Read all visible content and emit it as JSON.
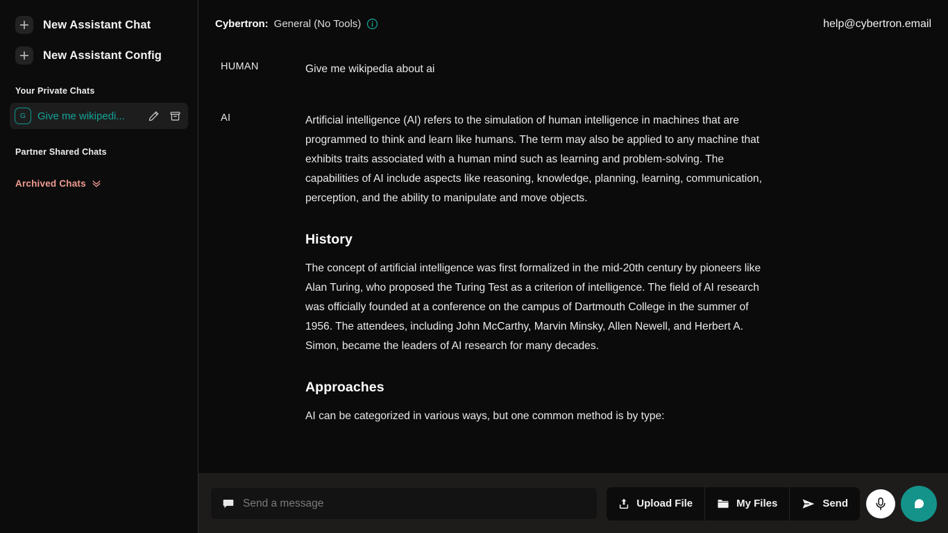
{
  "sidebar": {
    "new_chat_label": "New Assistant Chat",
    "new_config_label": "New Assistant Config",
    "private_chats_label": "Your Private Chats",
    "partner_chats_label": "Partner Shared Chats",
    "archived_chats_label": "Archived Chats",
    "chat_item": {
      "avatar_initial": "G",
      "title": "Give me wikipedi...",
      "edit_icon": "pencil-icon",
      "archive_icon": "archive-icon"
    },
    "new_icon": "plus-icon",
    "archived_icon": "chevron-double-down-icon",
    "accent_color": "#13a596",
    "archived_color": "#ef9b91"
  },
  "header": {
    "assistant_name": "Cybertron:",
    "assistant_mode": "General (No Tools)",
    "info_icon": "info-circle-icon",
    "account_email": "help@cybertron.email"
  },
  "conversation": {
    "messages": [
      {
        "role": "HUMAN",
        "paragraphs": [
          "Give me wikipedia about ai"
        ]
      },
      {
        "role": "AI",
        "paragraphs": [
          "Artificial intelligence (AI) refers to the simulation of human intelligence in machines that are programmed to think and learn like humans. The term may also be applied to any machine that exhibits traits associated with a human mind such as learning and problem-solving. The capabilities of AI include aspects like reasoning, knowledge, planning, learning, communication, perception, and the ability to manipulate and move objects."
        ],
        "sections": [
          {
            "heading": "History",
            "body": "The concept of artificial intelligence was first formalized in the mid-20th century by pioneers like Alan Turing, who proposed the Turing Test as a criterion of intelligence. The field of AI research was officially founded at a conference on the campus of Dartmouth College in the summer of 1956. The attendees, including John McCarthy, Marvin Minsky, Allen Newell, and Herbert A. Simon, became the leaders of AI research for many decades."
          },
          {
            "heading": "Approaches",
            "body": "AI can be categorized in various ways, but one common method is by type:"
          }
        ]
      }
    ]
  },
  "composer": {
    "placeholder": "Send a message",
    "input_icon": "speech-bubble-icon",
    "upload_file_label": "Upload File",
    "upload_file_icon": "upload-icon",
    "my_files_label": "My Files",
    "my_files_icon": "folder-icon",
    "send_label": "Send",
    "send_icon": "paper-plane-icon",
    "mic_icon": "microphone-icon",
    "fab_icon": "chat-bubble-icon",
    "fab_color": "#13938a"
  }
}
